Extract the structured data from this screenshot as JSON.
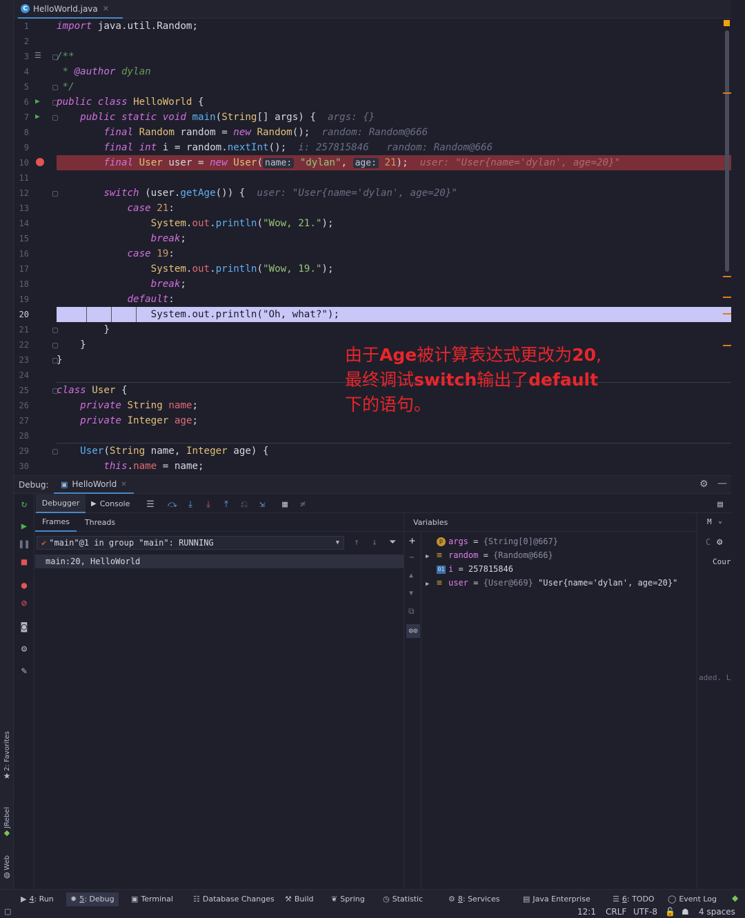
{
  "editor": {
    "tab_label": "HelloWorld.java",
    "line_numbers": [
      "1",
      "2",
      "3",
      "4",
      "5",
      "6",
      "7",
      "8",
      "9",
      "10",
      "11",
      "12",
      "13",
      "14",
      "15",
      "16",
      "17",
      "18",
      "19",
      "20",
      "21",
      "22",
      "23",
      "24",
      "25",
      "26",
      "27",
      "28",
      "29",
      "30"
    ],
    "lines": {
      "l1": {
        "kw": "import",
        "rest": " java.util.Random;"
      },
      "l3": "/**",
      "l4a": " * ",
      "l4tag": "@author",
      "l4name": " dylan",
      "l5": " */",
      "l6": {
        "kw1": "public",
        "kw2": "class",
        "name": "HelloWorld",
        "rest": " {"
      },
      "l7": {
        "kw1": "public",
        "kw2": "static",
        "kw3": "void",
        "fn": "main",
        "p1": "(",
        "cls": "String",
        "p2": "[] args) {",
        "hint": "args: {}"
      },
      "l8": {
        "kw": "final",
        "cls": "Random",
        "mid": " random = ",
        "kw2": "new",
        "cls2": "Random",
        "end": "();",
        "hint": "random: Random@666"
      },
      "l9": {
        "kw": "final",
        "kw2": "int",
        "mid": " i = random.",
        "fn": "nextInt",
        "end": "();",
        "hint": "i: 257815846   random: Random@666"
      },
      "l10": {
        "kw": "final",
        "cls": "User",
        "mid": " user = ",
        "kw2": "new",
        "cls2": "User",
        "p": "(",
        "h1": "name:",
        "s1": "\"dylan\"",
        "c": ", ",
        "h2": "age:",
        "n": "21",
        "end": ");",
        "hint": "user: \"User{name='dylan', age=20}\""
      },
      "l12": {
        "kw": "switch",
        "mid": " (user.",
        "fn": "getAge",
        "end": "()) {",
        "hint": "user: \"User{name='dylan', age=20}\""
      },
      "l13": {
        "kw": "case",
        "num": "21",
        "end": ":"
      },
      "l14": {
        "cls": "System",
        "dot": ".",
        "fld": "out",
        "dot2": ".",
        "fn": "println",
        "p": "(",
        "str": "\"Wow, 21.\"",
        "end": ");"
      },
      "l15": {
        "kw": "break",
        "end": ";"
      },
      "l16": {
        "kw": "case",
        "num": "19",
        "end": ":"
      },
      "l17": {
        "cls": "System",
        "dot": ".",
        "fld": "out",
        "dot2": ".",
        "fn": "println",
        "p": "(",
        "str": "\"Wow, 19.\"",
        "end": ");"
      },
      "l18": {
        "kw": "break",
        "end": ";"
      },
      "l19": {
        "kw": "default",
        "end": ":"
      },
      "l20": "System.out.println(\"Oh, what?\");",
      "l21": "}",
      "l22": "}",
      "l23": "}",
      "l25": {
        "kw": "class",
        "name": "User",
        "rest": " {"
      },
      "l26": {
        "kw": "private",
        "cls": "String",
        "fld": "name",
        "end": ";"
      },
      "l27": {
        "kw": "private",
        "cls": "Integer",
        "fld": "age",
        "end": ";"
      },
      "l29": {
        "fn": "User",
        "p": "(",
        "cls": "String",
        "a": " name, ",
        "cls2": "Integer",
        "b": " age) {"
      },
      "l30": {
        "kw": "this",
        "dot": ".",
        "fld": "name",
        "mid": " = ",
        "end": "name;"
      }
    }
  },
  "annotation": {
    "line1a": "由于",
    "line1b": "Age",
    "line1c": "被计算表达式更改为",
    "line1d": "20",
    "line1e": ",",
    "line2a": "最终调试",
    "line2b": "switch",
    "line2c": "输出了",
    "line2d": "default",
    "line3": "下的语句。"
  },
  "debug": {
    "label": "Debug:",
    "session_tab": "HelloWorld",
    "tabs": {
      "debugger": "Debugger",
      "console": "Console"
    },
    "frames_tab": "Frames",
    "threads_tab": "Threads",
    "thread_selector": "\"main\"@1 in group \"main\": RUNNING",
    "frame_item": "main:20, HelloWorld",
    "variables_title": "Variables",
    "variables": [
      {
        "name": "args",
        "eq": " = ",
        "value": "{String[0]@667}",
        "extra": ""
      },
      {
        "name": "random",
        "eq": " = ",
        "value": "{Random@666}",
        "extra": ""
      },
      {
        "name": "i",
        "eq": " = ",
        "value": "257815846",
        "extra": ""
      },
      {
        "name": "user",
        "eq": " = ",
        "value": "{User@669}",
        "extra": " \"User{name='dylan', age=20}\""
      }
    ],
    "right_panel_letter": "M",
    "right_panel_text1": "Cour",
    "right_panel_text2": "aded. L"
  },
  "left_strip": {
    "favorites": "2: Favorites",
    "jrebel": "JRebel",
    "web": "Web"
  },
  "bottom_tabs": [
    {
      "num": "4",
      "label": ": Run"
    },
    {
      "num": "5",
      "label": ": Debug"
    },
    {
      "num": "",
      "label": "Terminal"
    },
    {
      "num": "",
      "label": "Database Changes"
    },
    {
      "num": "",
      "label": "Build"
    },
    {
      "num": "",
      "label": "Spring"
    },
    {
      "num": "",
      "label": "Statistic"
    },
    {
      "num": "8",
      "label": ": Services"
    },
    {
      "num": "",
      "label": "Java Enterprise"
    },
    {
      "num": "6",
      "label": ": TODO"
    },
    {
      "num": "",
      "label": "Event Log"
    }
  ],
  "status": {
    "position": "12:1",
    "line_sep": "CRLF",
    "encoding": "UTF-8",
    "indent": "4 spaces"
  }
}
